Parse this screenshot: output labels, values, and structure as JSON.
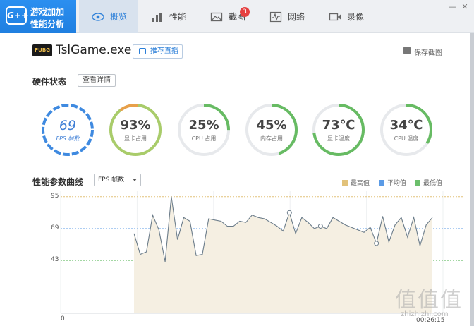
{
  "app": {
    "logo_badge": "G++",
    "logo_line1": "游戏加加",
    "logo_line2": "性能分析"
  },
  "tabs": [
    {
      "label": "概览",
      "icon": "eye-icon",
      "active": true
    },
    {
      "label": "性能",
      "icon": "bar-chart-icon"
    },
    {
      "label": "截图",
      "icon": "image-icon",
      "badge": "3"
    },
    {
      "label": "网络",
      "icon": "pulse-icon"
    },
    {
      "label": "录像",
      "icon": "video-icon"
    }
  ],
  "window_controls": {
    "minimize": "—",
    "close": "✕"
  },
  "game": {
    "icon_text": "PUBG",
    "title": "TslGame.exe",
    "recommend_live": "推荐直播",
    "save_screenshot": "保存截图"
  },
  "hardware": {
    "title": "硬件状态",
    "detail_button": "查看详情",
    "gauges": [
      {
        "value": "69",
        "label": "FPS 帧数",
        "fraction": 0.69,
        "color": "#3f8ae0"
      },
      {
        "value": "93%",
        "label": "显卡占用",
        "fraction": 0.93,
        "color": "#e8a04a"
      },
      {
        "value": "25%",
        "label": "CPU 占用",
        "fraction": 0.25,
        "color": "#67bb63"
      },
      {
        "value": "45%",
        "label": "内存占用",
        "fraction": 0.45,
        "color": "#67bb63"
      },
      {
        "value": "73℃",
        "label": "显卡温度",
        "fraction": 0.73,
        "color": "#67bb63"
      },
      {
        "value": "34℃",
        "label": "CPU 温度",
        "fraction": 0.34,
        "color": "#67bb63"
      }
    ]
  },
  "curve": {
    "title": "性能参数曲线",
    "select_value": "FPS 帧数",
    "legend": [
      {
        "label": "最高值",
        "color": "#e2c27a"
      },
      {
        "label": "平均值",
        "color": "#5b9be6"
      },
      {
        "label": "最低值",
        "color": "#6cbf6c"
      }
    ],
    "x_start_label": "0",
    "x_end_label": "00:26:15"
  },
  "chart_data": {
    "type": "area",
    "y_ticks": [
      95,
      69,
      43
    ],
    "max": 95,
    "avg": 69,
    "min": 43,
    "ylim": [
      0,
      100
    ],
    "values": [
      65,
      48,
      50,
      80,
      68,
      42,
      95,
      60,
      78,
      75,
      47,
      48,
      77,
      76,
      75,
      71,
      71,
      75,
      74,
      80,
      78,
      77,
      74,
      71,
      67,
      82,
      65,
      78,
      74,
      69,
      71,
      69,
      78,
      75,
      72,
      70,
      68,
      66,
      70,
      57,
      79,
      58,
      72,
      78,
      62,
      78,
      55,
      72,
      78
    ],
    "markers": [
      25,
      30,
      39
    ]
  },
  "watermark": {
    "text": "值值值",
    "site": "zhizhizhi.com"
  }
}
